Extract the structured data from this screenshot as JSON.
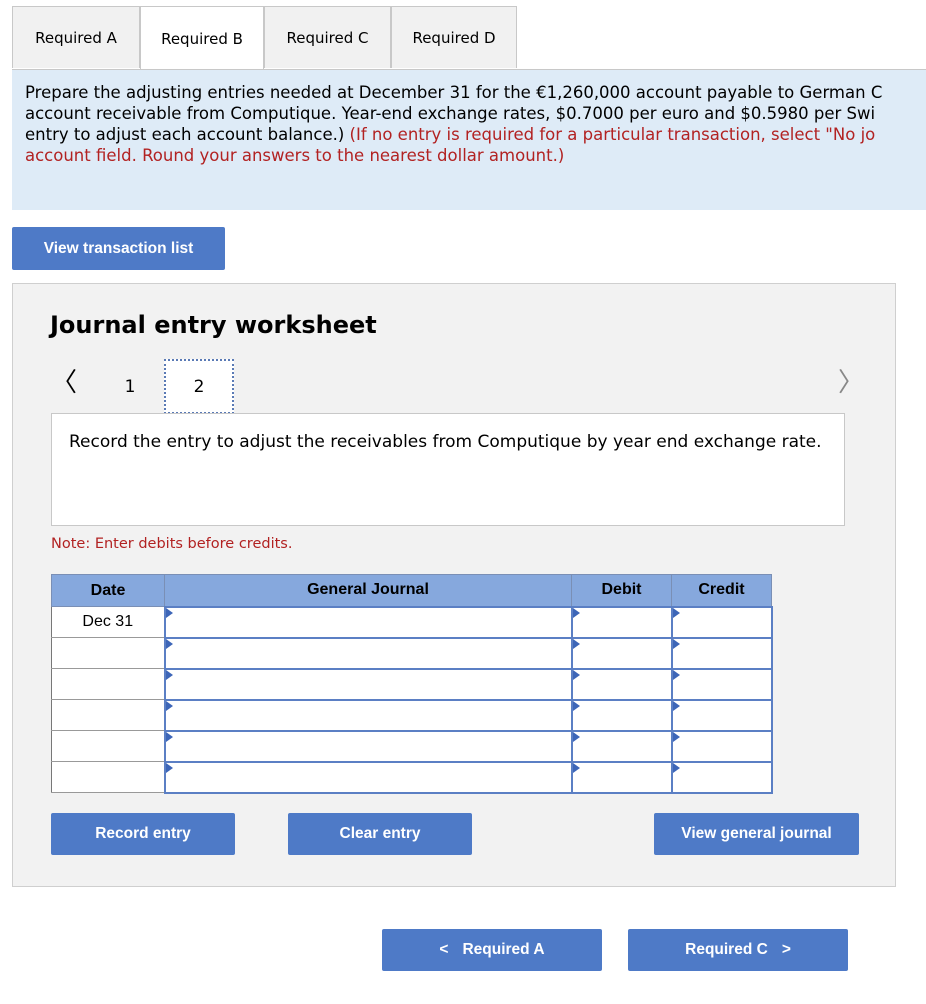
{
  "tabs": [
    "Required A",
    "Required B",
    "Required C",
    "Required D"
  ],
  "active_tab": "Required B",
  "question": {
    "line1": "Prepare the adjusting entries needed at December 31 for the €1,260,000 account payable to German C",
    "line2": "account receivable from Computique. Year-end exchange rates, $0.7000 per euro and $0.5980 per Swi",
    "line3_black": "entry to adjust each account balance.) ",
    "line3_red": "(If no entry is required for a particular transaction, select \"No jo",
    "line4_red": "account field. Round your answers to the nearest dollar amount.)"
  },
  "buttons": {
    "view_transactions": "View transaction list",
    "record_entry": "Record entry",
    "clear_entry": "Clear entry",
    "view_general_journal": "View general journal",
    "prev_required": "Required A",
    "next_required": "Required C"
  },
  "worksheet": {
    "title": "Journal entry worksheet",
    "pages": [
      "1",
      "2"
    ],
    "active_page": "2",
    "instruction": "Record the entry to adjust the receivables from Computique by year end exchange rate.",
    "note": "Note: Enter debits before credits."
  },
  "journal": {
    "headers": {
      "date": "Date",
      "general_journal": "General Journal",
      "debit": "Debit",
      "credit": "Credit"
    },
    "rows": [
      {
        "date": "Dec 31"
      },
      {
        "date": ""
      },
      {
        "date": ""
      },
      {
        "date": ""
      },
      {
        "date": ""
      },
      {
        "date": ""
      }
    ]
  },
  "colors": {
    "accent": "#4e7ac7",
    "question_bg": "#deebf7",
    "header_bg": "#86a8dd",
    "note_red": "#b22222"
  }
}
